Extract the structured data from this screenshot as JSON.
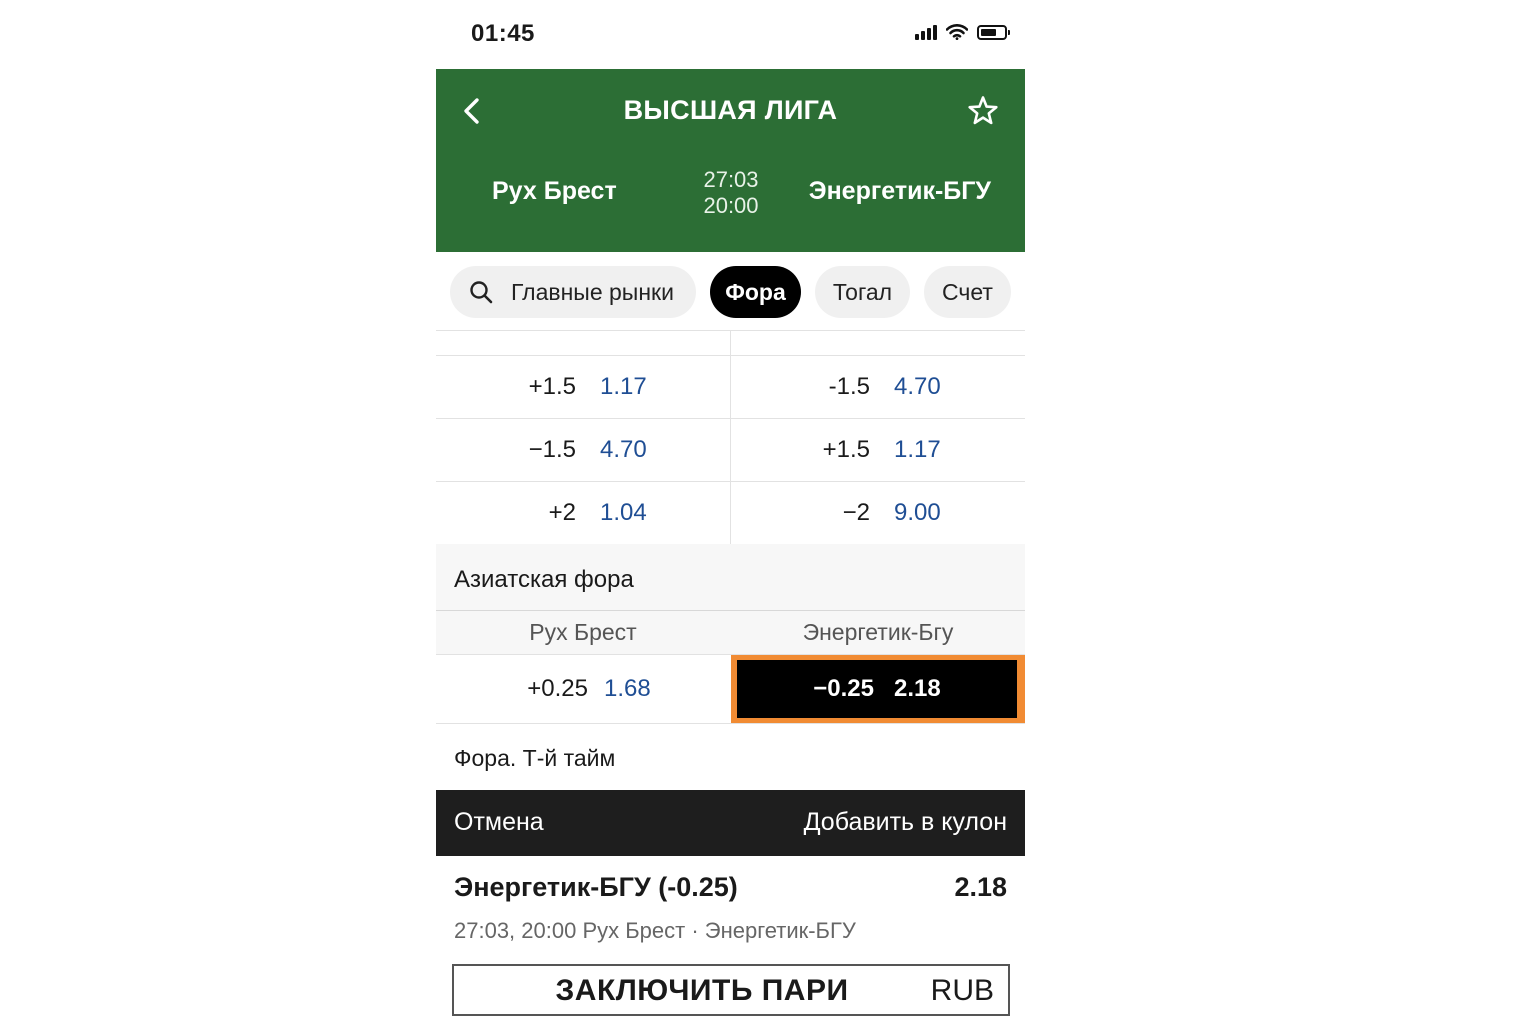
{
  "status_bar": {
    "time": "01:45"
  },
  "header": {
    "league": "ВЫСШАЯ ЛИГА",
    "home_team": "Рух Брест",
    "away_team": "Энергетик-БГУ",
    "date": "27:03",
    "time": "20:00"
  },
  "tabs": [
    {
      "label": "Главные рынки",
      "active": false,
      "icon": "search-icon"
    },
    {
      "label": "Фора",
      "active": true
    },
    {
      "label": "Тогал",
      "active": false
    },
    {
      "label": "Счет",
      "active": false
    }
  ],
  "handicap_rows": [
    {
      "left_hcp": "+1.5",
      "left_odd": "1.17",
      "right_hcp": "-1.5",
      "right_odd": "4.70"
    },
    {
      "left_hcp": "−1.5",
      "left_odd": "4.70",
      "right_hcp": "+1.5",
      "right_odd": "1.17"
    },
    {
      "left_hcp": "+2",
      "left_odd": "1.04",
      "right_hcp": "−2",
      "right_odd": "9.00"
    }
  ],
  "asian": {
    "title": "Азиатская фора",
    "col_home": "Рух Брест",
    "col_away": "Энергетик-Бгу",
    "left_hcp": "+0.25",
    "left_odd": "1.68",
    "right_hcp": "−0.25",
    "right_odd": "2.18"
  },
  "next_section": "Фора. Т-й тайм",
  "action_bar": {
    "cancel": "Отмена",
    "add": "Добавить в кулон"
  },
  "bet_slip": {
    "title": "Энергетик-БГУ (-0.25)",
    "odd": "2.18",
    "subtitle": "27:03, 20:00 Рух Брест · Энергетик-БГУ",
    "place_label": "ЗАКЛЮЧИТЬ ПАРИ",
    "currency": "RUB"
  },
  "colors": {
    "header_bg": "#2c6e35",
    "odd_blue": "#1f4e94",
    "selection_border": "#f18b33"
  }
}
